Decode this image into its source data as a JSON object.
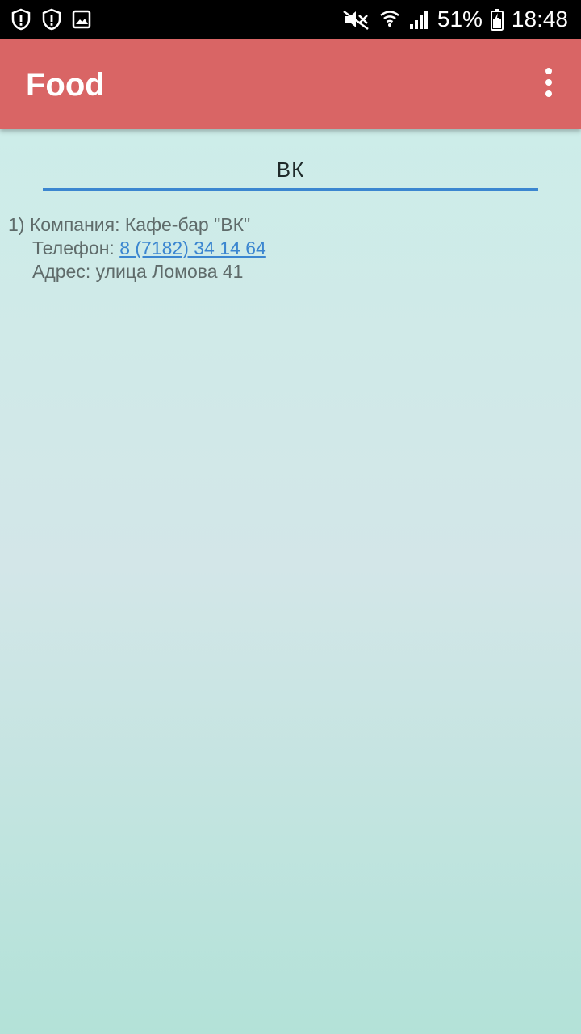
{
  "status_bar": {
    "icons_left": [
      "alert-shield-icon",
      "alert-shield-icon",
      "image-icon"
    ],
    "icons_right": [
      "mute-icon",
      "wifi-icon",
      "signal-icon",
      "battery-charging-icon"
    ],
    "battery_percent": "51%",
    "time": "18:48"
  },
  "app_bar": {
    "title": "Food",
    "menu_icon": "more-vert-icon",
    "color": "#d96565"
  },
  "section": {
    "heading": "ВК",
    "accent_color": "#3b86d0"
  },
  "entries": [
    {
      "number": "1)",
      "company_label": "Компания:",
      "company": "Кафе-бар \"ВК\"",
      "phone_label": "Телефон:",
      "phone": "8 (7182) 34 14 64",
      "address_label": "Адрес:",
      "address": "улица Ломова 41"
    }
  ]
}
